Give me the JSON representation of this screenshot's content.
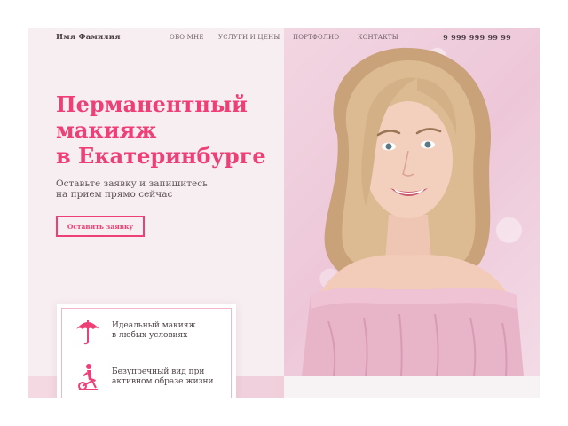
{
  "header": {
    "logo": "Имя Фамилия",
    "nav": [
      "ОБО МНЕ",
      "УСЛУГИ И ЦЕНЫ",
      "ПОРТФОЛИО",
      "КОНТАКТЫ"
    ],
    "phone": "9 999 999 99 99"
  },
  "hero": {
    "title_lines": [
      "Перманентный",
      "макияж",
      "в Екатеринбурге"
    ],
    "subtitle_lines": [
      "Оставьте заявку и запишитесь",
      "на прием прямо сейчас"
    ],
    "cta_label": "Оставить заявку"
  },
  "features": [
    {
      "icon": "umbrella-icon",
      "lines": [
        "Идеальный макияж",
        "в любых условиях"
      ]
    },
    {
      "icon": "exercise-bike-icon",
      "lines": [
        "Безупречный вид при",
        "активном образе жизни"
      ]
    }
  ],
  "colors": {
    "accent": "#ee3f76",
    "background": "#f7eef1",
    "text": "#4b3f45"
  }
}
